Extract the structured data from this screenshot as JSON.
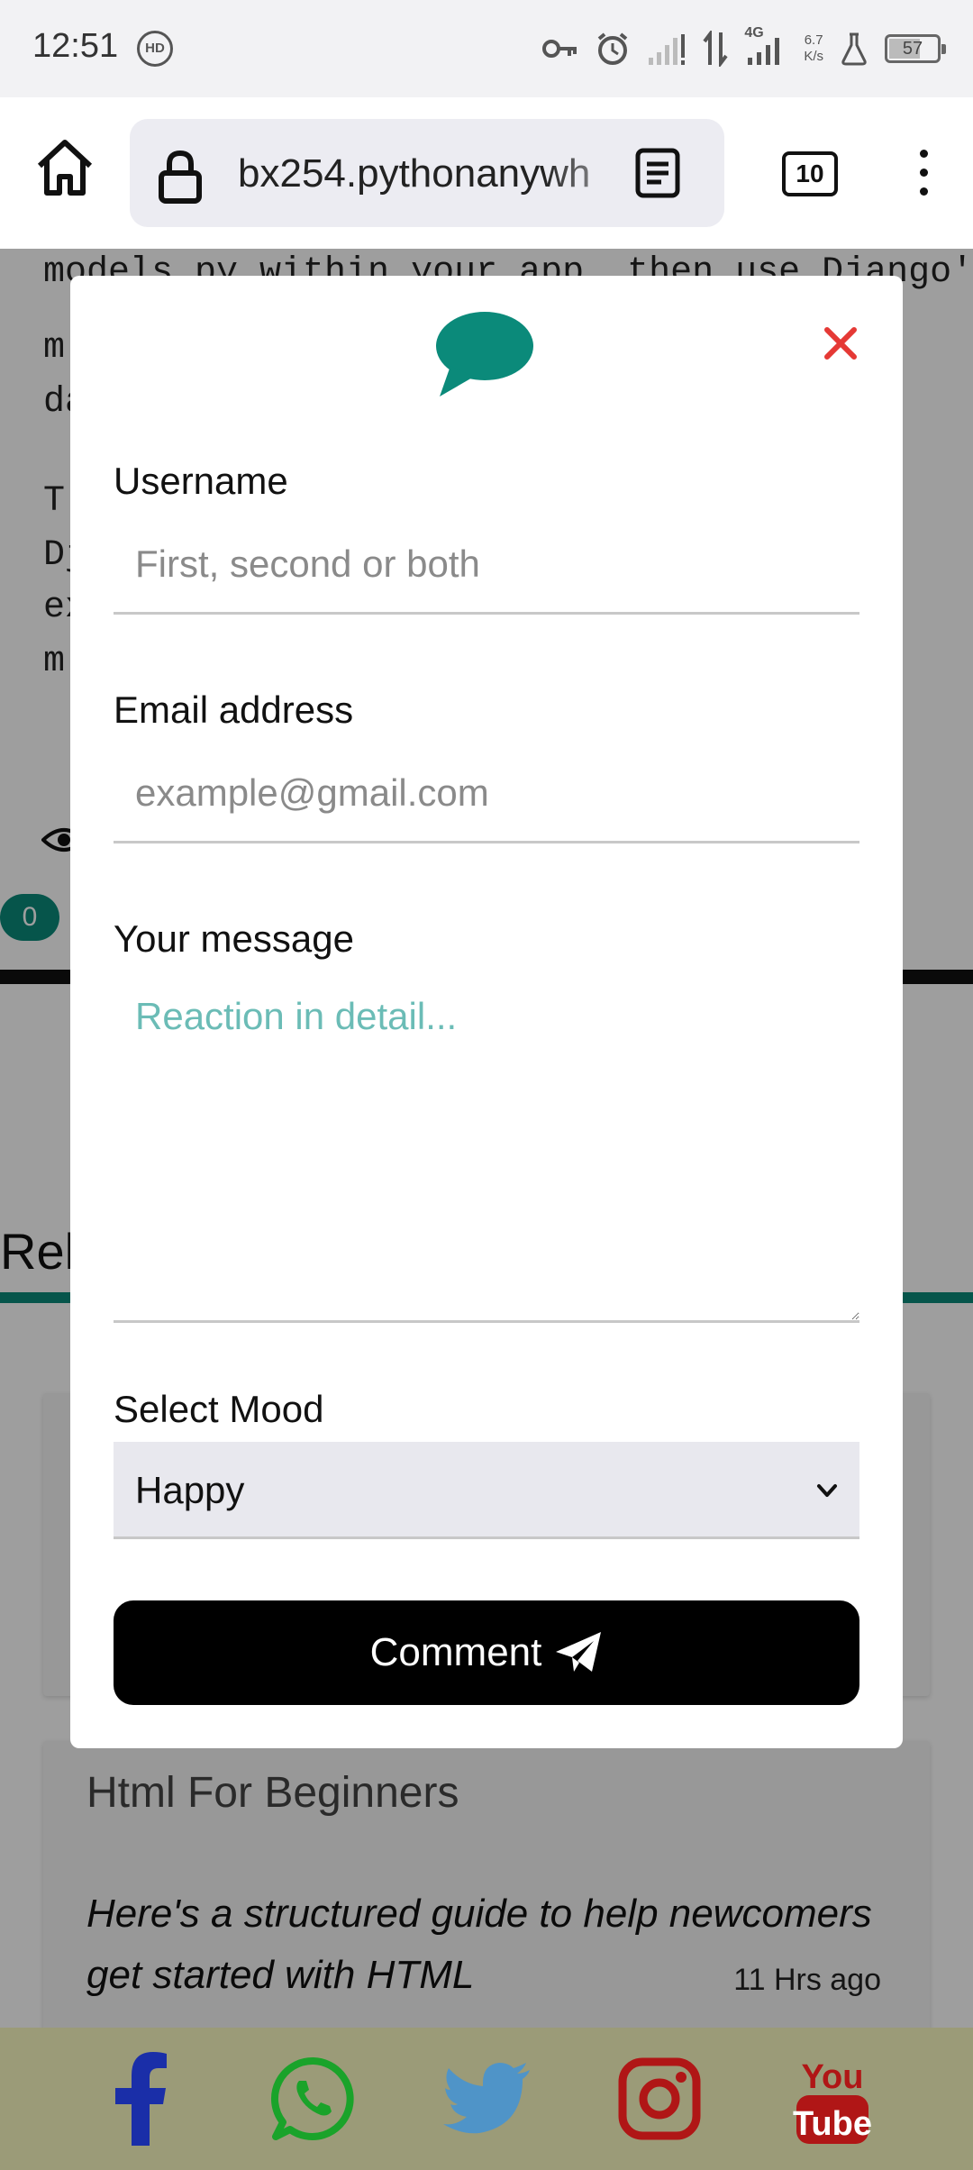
{
  "status_bar": {
    "time": "12:51",
    "hd_badge": "HD",
    "net_speed_top": "6.7",
    "net_speed_bottom": "K/s",
    "network_type": "4G",
    "battery": "57"
  },
  "browser": {
    "url": "bx254.pythonanywh",
    "tab_count": "10"
  },
  "page": {
    "code_line": "models.py within your app, then use Django's",
    "line_fragments": [
      "m",
      "da",
      "T",
      "Dj",
      "ex",
      "m"
    ],
    "comment_count": "0",
    "related_heading": "Rel",
    "cards": [
      {
        "title": "",
        "desc": "",
        "time": ""
      },
      {
        "title": "Html For Beginners",
        "desc": "Here's a structured guide to help newcomers get started with HTML",
        "time": "11 Hrs ago"
      }
    ]
  },
  "modal": {
    "username_label": "Username",
    "username_placeholder": "First, second or both",
    "email_label": "Email address",
    "email_placeholder": "example@gmail.com",
    "message_label": "Your message",
    "message_placeholder": "Reaction in detail...",
    "mood_label": "Select Mood",
    "mood_value": "Happy",
    "submit_label": "Comment"
  },
  "social": [
    "facebook-icon",
    "whatsapp-icon",
    "twitter-icon",
    "instagram-icon",
    "youtube-icon"
  ],
  "colors": {
    "accent": "#0b8a7a",
    "close": "#e53935",
    "social_bar": "#9b9b78"
  }
}
